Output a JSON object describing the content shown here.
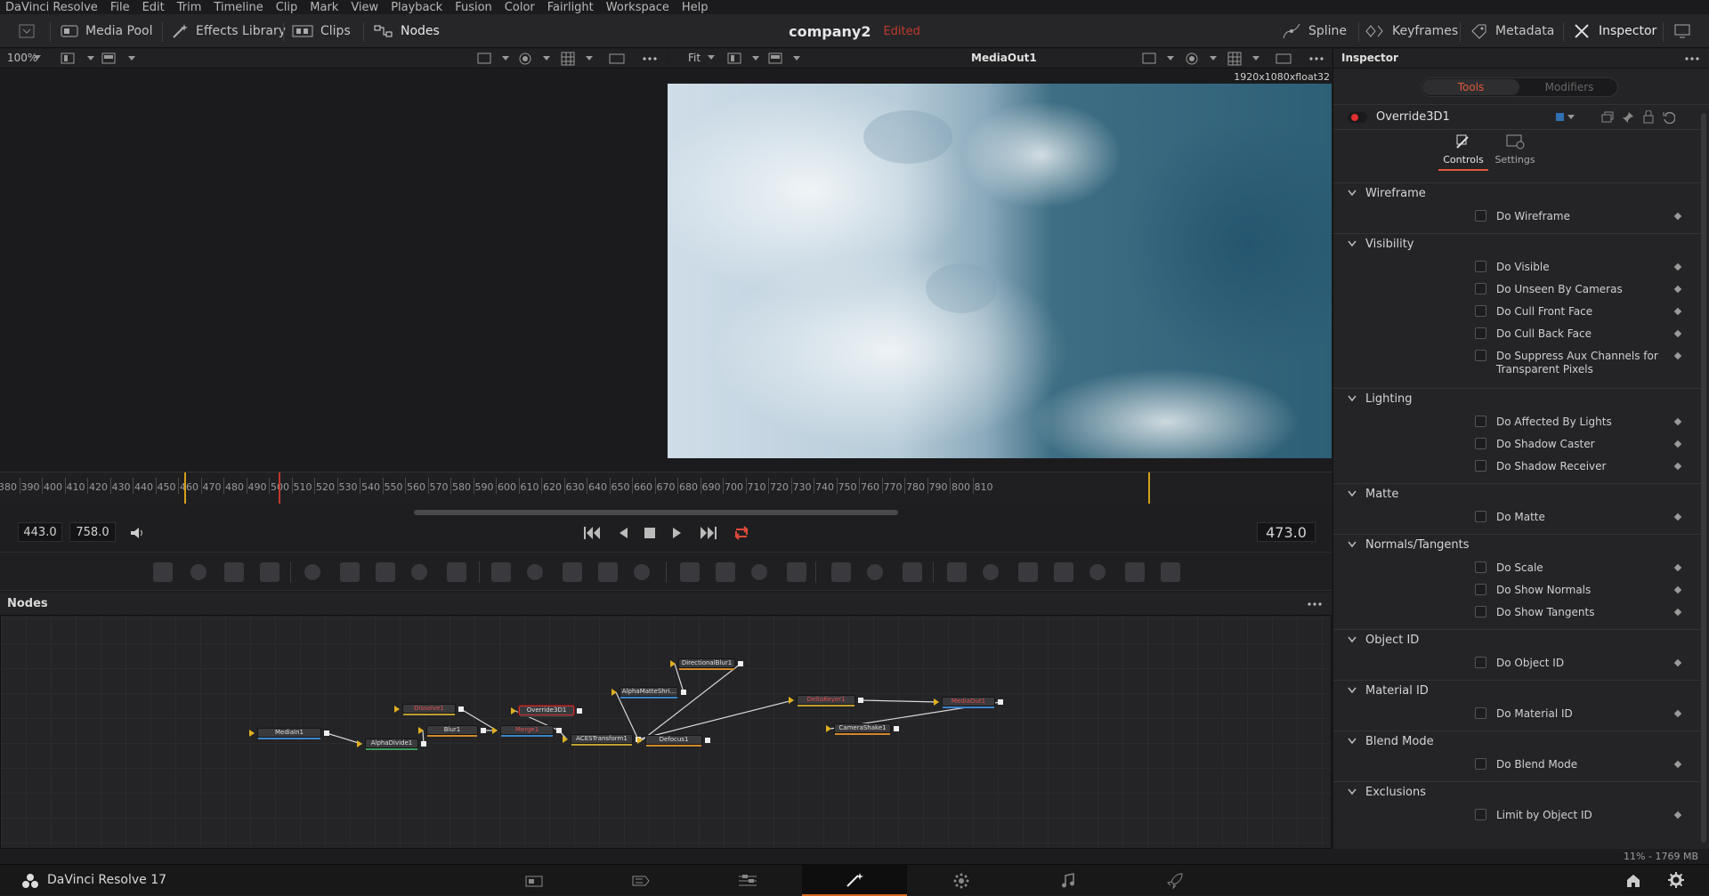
{
  "menubar": [
    "DaVinci Resolve",
    "File",
    "Edit",
    "Trim",
    "Timeline",
    "Clip",
    "Mark",
    "View",
    "Playback",
    "Fusion",
    "Color",
    "Fairlight",
    "Workspace",
    "Help"
  ],
  "toolbar": {
    "media_pool": "Media Pool",
    "effects_library": "Effects Library",
    "clips": "Clips",
    "nodes": "Nodes",
    "project_name": "company2",
    "edited": "Edited",
    "spline": "Spline",
    "keyframes": "Keyframes",
    "metadata": "Metadata",
    "inspector": "Inspector"
  },
  "viewer_left": {
    "zoom": "100%"
  },
  "viewer_right": {
    "fit": "Fit",
    "title": "MediaOut1",
    "resolution": "1920x1080xfloat32"
  },
  "ruler": {
    "ticks": [
      "380",
      "390",
      "400",
      "410",
      "420",
      "430",
      "440",
      "450",
      "460",
      "470",
      "480",
      "490",
      "500",
      "510",
      "520",
      "530",
      "540",
      "550",
      "560",
      "570",
      "580",
      "590",
      "600",
      "610",
      "620",
      "630",
      "640",
      "650",
      "660",
      "670",
      "680",
      "690",
      "700",
      "710",
      "720",
      "730",
      "740",
      "750",
      "760",
      "770",
      "780",
      "790",
      "800",
      "810"
    ]
  },
  "transport": {
    "in_point": "443.0",
    "out_point": "758.0",
    "current_frame": "473.0"
  },
  "nodes_panel": {
    "title": "Nodes",
    "nodes": [
      {
        "name": "MediaIn1",
        "color": "#3b86c7"
      },
      {
        "name": "AlphaDivide1",
        "color": "#3a9a5b"
      },
      {
        "name": "Dissolve1",
        "color": "#c0a030"
      },
      {
        "name": "Blur1",
        "color": "#d08a2a"
      },
      {
        "name": "Override3D1",
        "color": "#3a3a3d"
      },
      {
        "name": "Merge1",
        "color": "#3b86c7"
      },
      {
        "name": "ACESTransform1",
        "color": "#c0a030"
      },
      {
        "name": "AlphaMatteShri...",
        "color": "#3b86c7"
      },
      {
        "name": "DirectionalBlur1",
        "color": "#d08a2a"
      },
      {
        "name": "Defocus1",
        "color": "#d08a2a"
      },
      {
        "name": "DeltaKeyer1",
        "color": "#c0a030"
      },
      {
        "name": "CameraShake1",
        "color": "#d08a2a"
      },
      {
        "name": "MediaOut1",
        "color": "#3b86c7"
      }
    ]
  },
  "inspector": {
    "title": "Inspector",
    "tabs": [
      "Tools",
      "Modifiers"
    ],
    "node_name": "Override3D1",
    "sub_tabs": [
      "Controls",
      "Settings"
    ],
    "sections": [
      {
        "name": "Wireframe",
        "items": [
          "Do Wireframe"
        ]
      },
      {
        "name": "Visibility",
        "items": [
          "Do Visible",
          "Do Unseen By Cameras",
          "Do Cull Front Face",
          "Do Cull Back Face",
          "Do Suppress Aux Channels for Transparent Pixels"
        ]
      },
      {
        "name": "Lighting",
        "items": [
          "Do Affected By Lights",
          "Do Shadow Caster",
          "Do Shadow Receiver"
        ]
      },
      {
        "name": "Matte",
        "items": [
          "Do Matte"
        ]
      },
      {
        "name": "Normals/Tangents",
        "items": [
          "Do Scale",
          "Do Show Normals",
          "Do Show Tangents"
        ]
      },
      {
        "name": "Object ID",
        "items": [
          "Do Object ID"
        ]
      },
      {
        "name": "Material ID",
        "items": [
          "Do Material ID"
        ]
      },
      {
        "name": "Blend Mode",
        "items": [
          "Do Blend Mode"
        ]
      },
      {
        "name": "Exclusions",
        "items": [
          "Limit by Object ID"
        ]
      }
    ]
  },
  "status": {
    "memory": "11% - 1769 MB"
  },
  "bottombar": {
    "app_name": "DaVinci Resolve 17"
  },
  "colors": {
    "accent_red": "#c0392b",
    "active_tab": "#e05a3a",
    "playhead": "#d4a017"
  }
}
